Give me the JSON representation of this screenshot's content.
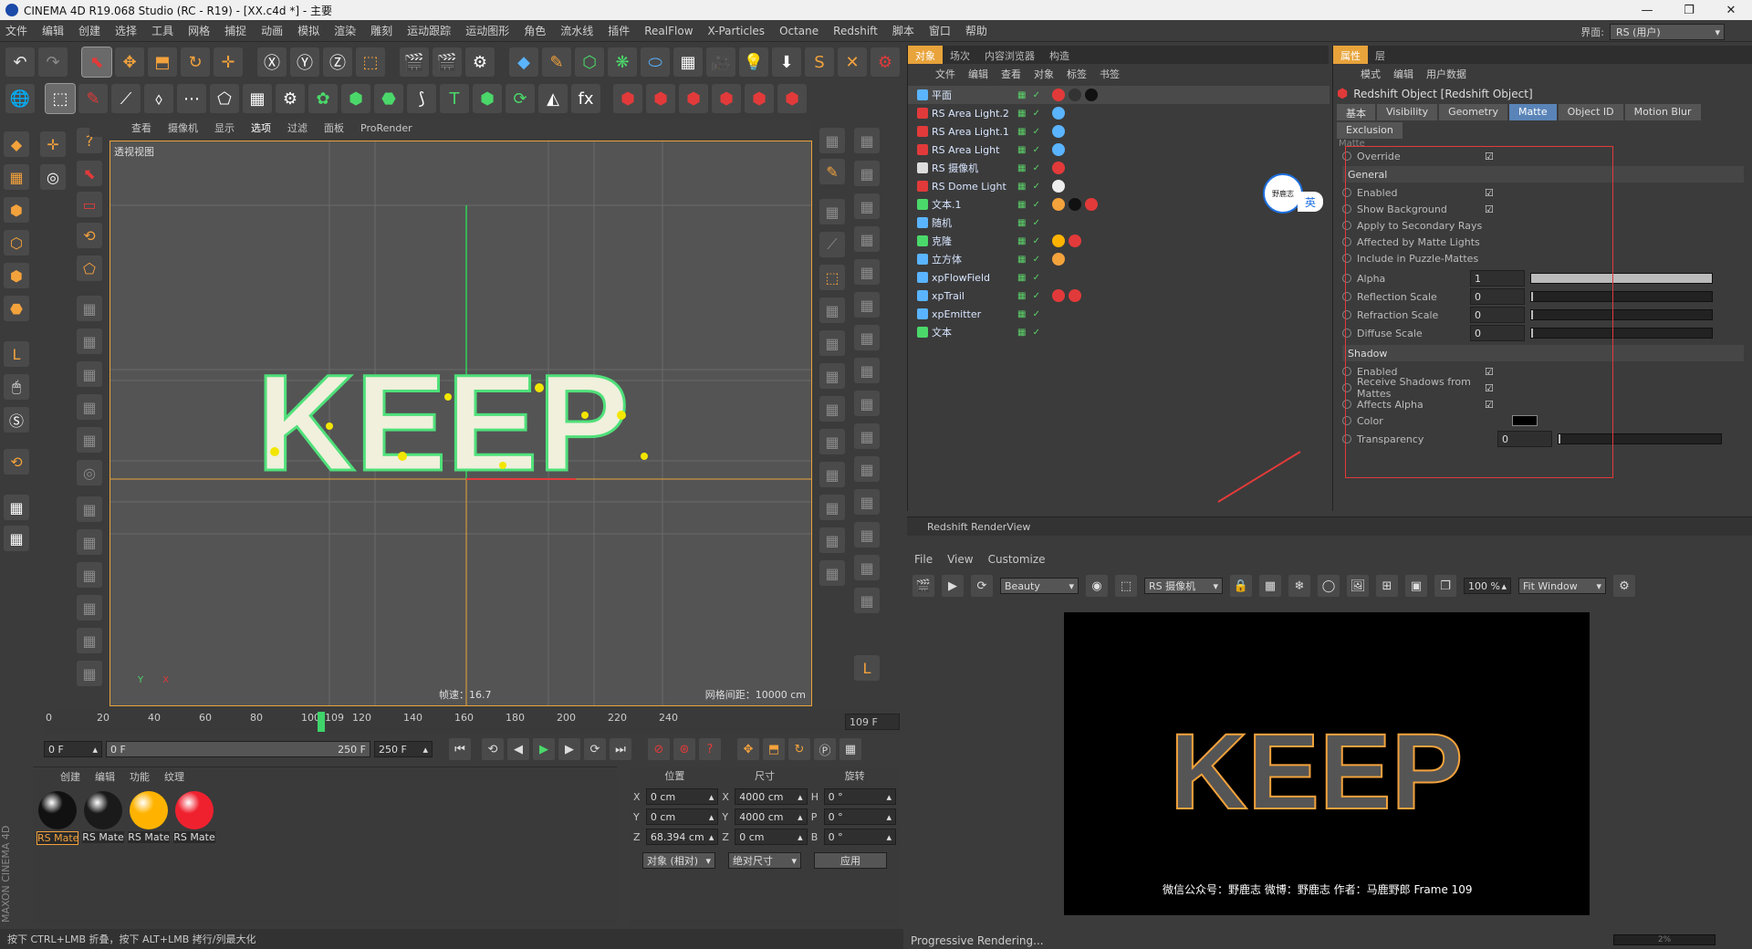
{
  "window": {
    "title": "CINEMA 4D R19.068 Studio (RC - R19) - [XX.c4d *] - 主要",
    "controls": [
      "—",
      "❐",
      "✕"
    ]
  },
  "menu": [
    "文件",
    "编辑",
    "创建",
    "选择",
    "工具",
    "网格",
    "捕捉",
    "动画",
    "模拟",
    "渲染",
    "雕刻",
    "运动跟踪",
    "运动图形",
    "角色",
    "流水线",
    "插件",
    "RealFlow",
    "X-Particles",
    "Octane",
    "Redshift",
    "脚本",
    "窗口",
    "帮助"
  ],
  "layout": {
    "label": "界面:",
    "value": "RS (用户)"
  },
  "viewport": {
    "menu": [
      "查看",
      "摄像机",
      "显示",
      "选项",
      "过滤",
      "面板",
      "ProRender"
    ],
    "active_menu": "选项",
    "title": "透视视图",
    "speed": "帧速：16.7",
    "grid": "网格间距：10000 cm",
    "text3d": "KEEP",
    "axes": {
      "y": "Y",
      "x": "X"
    }
  },
  "timeline": {
    "ticks": [
      "0",
      "20",
      "40",
      "60",
      "80",
      "100",
      "109",
      "120",
      "140",
      "160",
      "180",
      "200",
      "220",
      "240"
    ],
    "current": "109 F"
  },
  "transport": {
    "start": "0 F",
    "range_start": "0 F",
    "range_end": "250 F",
    "end": "250 F"
  },
  "materials": {
    "menu": [
      "创建",
      "编辑",
      "功能",
      "纹理"
    ],
    "items": [
      {
        "name": "RS Mate",
        "color": "#111111"
      },
      {
        "name": "RS Mate",
        "color": "#1a1a1a"
      },
      {
        "name": "RS Mate",
        "color": "#ffb300"
      },
      {
        "name": "RS Mate",
        "color": "#f0212f"
      }
    ]
  },
  "coords": {
    "headers": [
      "位置",
      "尺寸",
      "旋转"
    ],
    "rows": [
      {
        "a": "X",
        "p": "0 cm",
        "b": "X",
        "s": "4000 cm",
        "c": "H",
        "r": "0 °"
      },
      {
        "a": "Y",
        "p": "0 cm",
        "b": "Y",
        "s": "4000 cm",
        "c": "P",
        "r": "0 °"
      },
      {
        "a": "Z",
        "p": "68.394 cm",
        "b": "Z",
        "s": "0 cm",
        "c": "B",
        "r": "0 °"
      }
    ],
    "mode1": "对象 (相对)",
    "mode2": "绝对尺寸",
    "apply": "应用"
  },
  "statusbar": "按下 CTRL+LMB 折叠，按下 ALT+LMB 拷行/列最大化",
  "maxon": "MAXON CINEMA 4D",
  "objects": {
    "tabs": [
      "对象",
      "场次",
      "内容浏览器",
      "构造"
    ],
    "menu": [
      "文件",
      "编辑",
      "查看",
      "对象",
      "标签",
      "书签"
    ],
    "rows": [
      {
        "name": "平面",
        "icon": "#5ab4ff"
      },
      {
        "name": "RS Area Light.2",
        "icon": "#e23a3a"
      },
      {
        "name": "RS Area Light.1",
        "icon": "#e23a3a"
      },
      {
        "name": "RS Area Light",
        "icon": "#e23a3a"
      },
      {
        "name": "RS 摄像机",
        "icon": "#dddddd"
      },
      {
        "name": "RS Dome Light",
        "icon": "#e23a3a"
      },
      {
        "name": "文本.1",
        "icon": "#4bd86a"
      },
      {
        "name": "随机",
        "icon": "#5ab4ff"
      },
      {
        "name": "克隆",
        "icon": "#4bd86a"
      },
      {
        "name": "立方体",
        "icon": "#5ab4ff"
      },
      {
        "name": "xpFlowField",
        "icon": "#5ab4ff"
      },
      {
        "name": "xpTrail",
        "icon": "#5ab4ff"
      },
      {
        "name": "xpEmitter",
        "icon": "#5ab4ff"
      },
      {
        "name": "文本",
        "icon": "#4bd86a"
      }
    ]
  },
  "attributes": {
    "tabs": [
      "属性",
      "层"
    ],
    "menu": [
      "模式",
      "编辑",
      "用户数据"
    ],
    "object": "Redshift Object [Redshift Object]",
    "ptabs": [
      "基本",
      "Visibility",
      "Geometry",
      "Matte",
      "Object ID",
      "Motion Blur"
    ],
    "active_ptab": "Matte",
    "exclusion": "Exclusion",
    "matte_label": "Matte",
    "override": "Override",
    "general": "General",
    "general_props": [
      "Enabled",
      "Show Background",
      "Apply to Secondary Rays",
      "Affected by Matte Lights",
      "Include in Puzzle-Mattes"
    ],
    "sliders": [
      {
        "label": "Alpha",
        "value": "1"
      },
      {
        "label": "Reflection Scale",
        "value": "0"
      },
      {
        "label": "Refraction Scale",
        "value": "0"
      },
      {
        "label": "Diffuse Scale",
        "value": "0"
      }
    ],
    "shadow": "Shadow",
    "shadow_props": [
      "Enabled",
      "Receive Shadows from Mattes",
      "Affects Alpha"
    ],
    "color_label": "Color",
    "transparency": {
      "label": "Transparency",
      "value": "0"
    }
  },
  "ime": {
    "label": "英",
    "badge": "野鹿志"
  },
  "renderview": {
    "title": "Redshift RenderView",
    "menu": [
      "File",
      "View",
      "Customize"
    ],
    "aov": "Beauty",
    "camera": "RS 摄像机",
    "zoom": "100 %",
    "fit": "Fit Window",
    "caption": "微信公众号：野鹿志   微博：野鹿志   作者：马鹿野郎  Frame  109",
    "status": "Progressive Rendering...",
    "progress": "2%"
  }
}
